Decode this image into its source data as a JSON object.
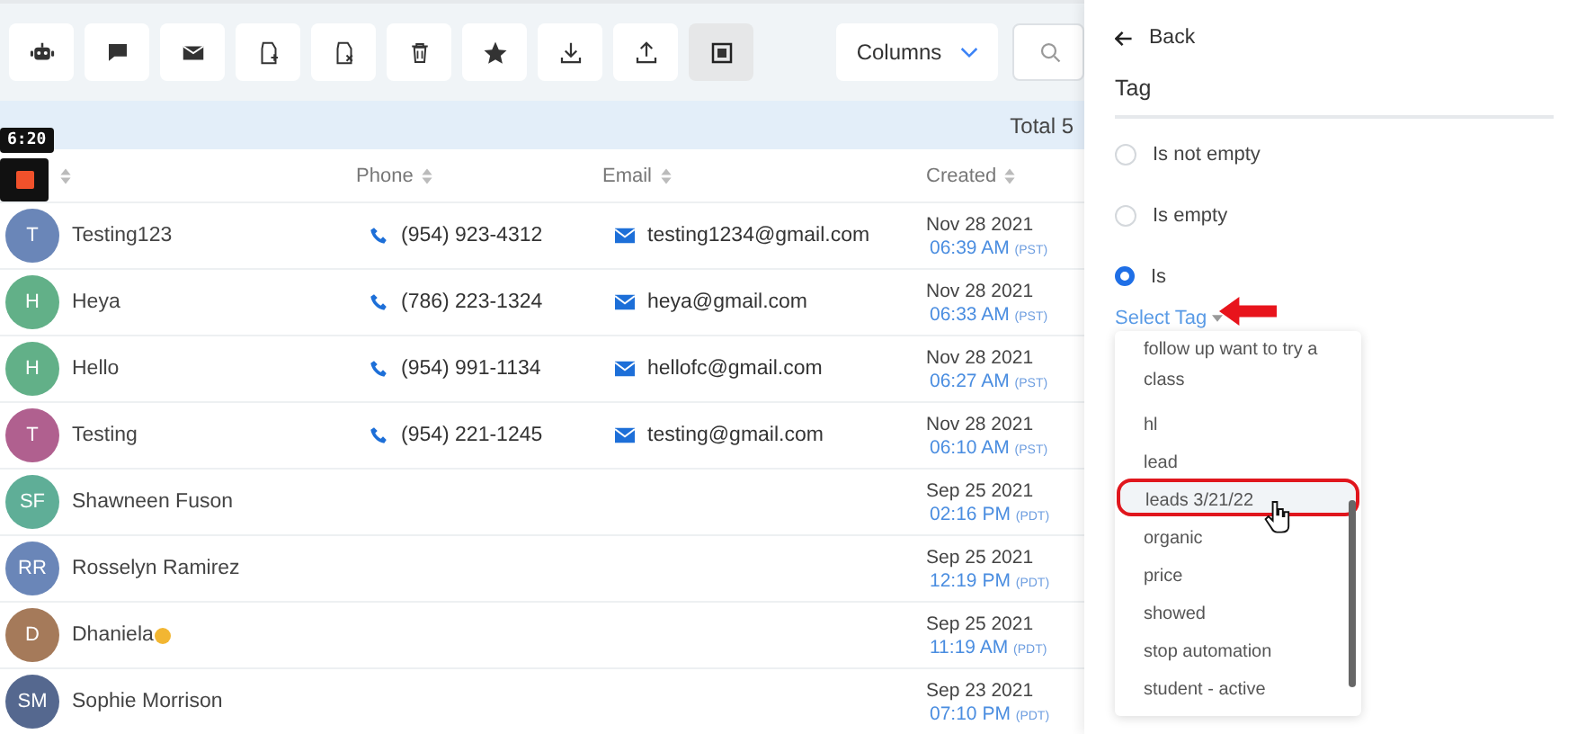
{
  "toolbar": [
    {
      "kind": "robot",
      "selected": false
    },
    {
      "kind": "chat",
      "selected": false
    },
    {
      "kind": "mail",
      "selected": false
    },
    {
      "kind": "tag-add",
      "selected": false
    },
    {
      "kind": "tag-remove",
      "selected": false
    },
    {
      "kind": "trash",
      "selected": false
    },
    {
      "kind": "star",
      "selected": false
    },
    {
      "kind": "download",
      "selected": false
    },
    {
      "kind": "upload",
      "selected": false
    },
    {
      "kind": "select",
      "selected": true
    }
  ],
  "columns_button": "Columns",
  "total": "Total 5",
  "recorder": {
    "time": "6:20"
  },
  "table": {
    "columns": [
      "Phone",
      "Email",
      "Created"
    ],
    "rows": [
      {
        "initials": "T",
        "color": "#6a86b8",
        "name": "Testing123",
        "emoji": false,
        "phone": "(954) 923-4312",
        "email": "testing1234@gmail.com",
        "date": "Nov 28 2021",
        "time": "06:39 AM",
        "tz": "(PST)"
      },
      {
        "initials": "H",
        "color": "#62b088",
        "name": "Heya",
        "emoji": false,
        "phone": "(786) 223-1324",
        "email": "heya@gmail.com",
        "date": "Nov 28 2021",
        "time": "06:33 AM",
        "tz": "(PST)"
      },
      {
        "initials": "H",
        "color": "#62b088",
        "name": "Hello",
        "emoji": false,
        "phone": "(954) 991-1134",
        "email": "hellofc@gmail.com",
        "date": "Nov 28 2021",
        "time": "06:27 AM",
        "tz": "(PST)"
      },
      {
        "initials": "T",
        "color": "#b0608f",
        "name": "Testing",
        "emoji": false,
        "phone": "(954) 221-1245",
        "email": "testing@gmail.com",
        "date": "Nov 28 2021",
        "time": "06:10 AM",
        "tz": "(PST)"
      },
      {
        "initials": "SF",
        "color": "#5fae97",
        "name": "Shawneen Fuson",
        "emoji": false,
        "date": "Sep 25 2021",
        "time": "02:16 PM",
        "tz": "(PDT)"
      },
      {
        "initials": "RR",
        "color": "#6a86b8",
        "name": "Rosselyn Ramirez",
        "emoji": false,
        "date": "Sep 25 2021",
        "time": "12:19 PM",
        "tz": "(PDT)"
      },
      {
        "initials": "D",
        "color": "#a57a5a",
        "name": "Dhaniela",
        "emoji": true,
        "date": "Sep 25 2021",
        "time": "11:19 AM",
        "tz": "(PDT)"
      },
      {
        "initials": "SM",
        "color": "#55688f",
        "name": "Sophie Morrison",
        "emoji": false,
        "date": "Sep 23 2021",
        "time": "07:10 PM",
        "tz": "(PDT)"
      }
    ]
  },
  "panel": {
    "back": "Back",
    "title": "Tag",
    "options": [
      {
        "label": "Is not empty",
        "selected": false
      },
      {
        "label": "Is empty",
        "selected": false
      },
      {
        "label": "Is",
        "selected": true
      }
    ],
    "select_label": "Select Tag",
    "tags": [
      {
        "label": "follow up want to try a class",
        "selected": false
      },
      {
        "label": "hl",
        "selected": false
      },
      {
        "label": "lead",
        "selected": false
      },
      {
        "label": "leads 3/21/22",
        "selected": true
      },
      {
        "label": "organic",
        "selected": false
      },
      {
        "label": "price",
        "selected": false
      },
      {
        "label": "showed",
        "selected": false
      },
      {
        "label": "stop automation",
        "selected": false
      },
      {
        "label": "student - active",
        "selected": false
      }
    ]
  }
}
